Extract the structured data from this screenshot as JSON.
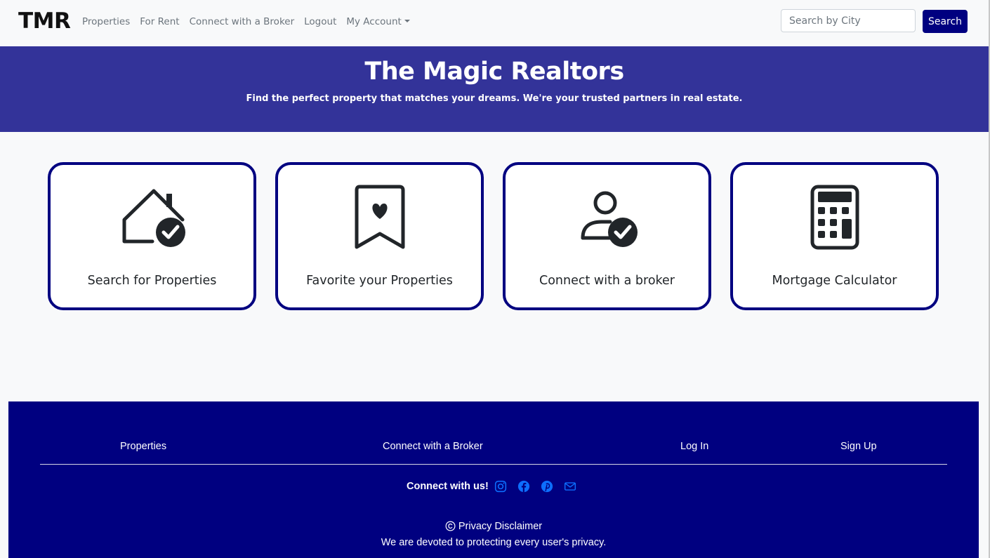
{
  "navbar": {
    "brand": "TMR",
    "links": [
      "Properties",
      "For Rent",
      "Connect with a Broker",
      "Logout",
      "My Account"
    ],
    "search_placeholder": "Search by City",
    "search_button": "Search"
  },
  "hero": {
    "title": "The Magic Realtors",
    "subtitle": "Find the perfect property that matches your dreams. We're your trusted partners in real estate."
  },
  "features": [
    {
      "label": "Search for Properties",
      "icon": "house-check-icon"
    },
    {
      "label": "Favorite your Properties",
      "icon": "bookmark-heart-icon"
    },
    {
      "label": "Connect with a broker",
      "icon": "person-check-icon"
    },
    {
      "label": "Mortgage Calculator",
      "icon": "calculator-icon"
    }
  ],
  "footer": {
    "links": [
      "Properties",
      "Connect with a Broker",
      "Log In",
      "Sign Up"
    ],
    "connect_label": "Connect with us!",
    "social_icons": [
      "instagram-icon",
      "facebook-icon",
      "pinterest-icon",
      "envelope-icon"
    ],
    "privacy_title": "Privacy Disclaimer",
    "privacy_text": "We are devoted to protecting every user's privacy."
  },
  "colors": {
    "primary": "#000080",
    "hero": "#333399",
    "social": "#0d6efd",
    "background": "#f8f9fa"
  }
}
